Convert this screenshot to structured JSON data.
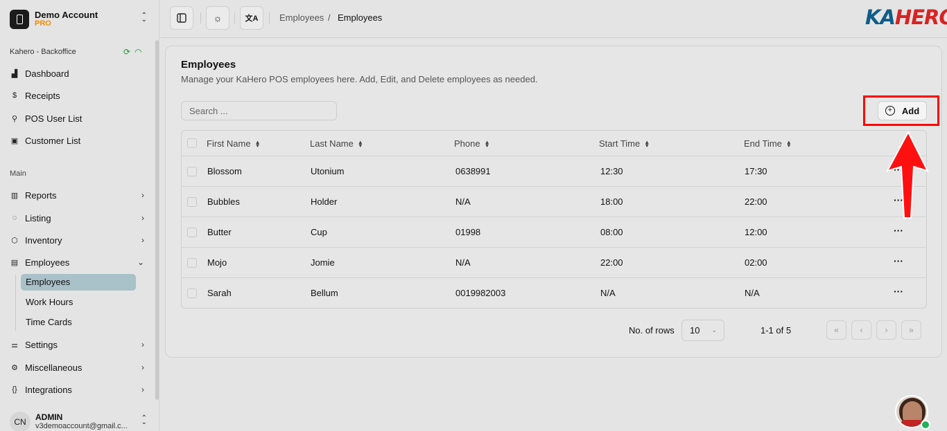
{
  "account": {
    "name": "Demo Account",
    "plan": "PRO"
  },
  "org": "Kahero - Backoffice",
  "nav_top": [
    {
      "label": "Dashboard",
      "icon": "chart-icon"
    },
    {
      "label": "Receipts",
      "icon": "receipt-icon"
    },
    {
      "label": "POS User List",
      "icon": "user-icon"
    },
    {
      "label": "Customer List",
      "icon": "contact-icon"
    }
  ],
  "section_label": "Main",
  "nav_main": [
    {
      "label": "Reports",
      "icon": "report-icon"
    },
    {
      "label": "Listing",
      "icon": "apple-icon"
    },
    {
      "label": "Inventory",
      "icon": "box-icon"
    },
    {
      "label": "Employees",
      "icon": "id-card-icon"
    }
  ],
  "employees_sub": [
    "Employees",
    "Work Hours",
    "Time Cards"
  ],
  "nav_bottom": [
    {
      "label": "Settings",
      "icon": "sliders-icon"
    },
    {
      "label": "Miscellaneous",
      "icon": "gear-icon"
    },
    {
      "label": "Integrations",
      "icon": "braces-icon"
    }
  ],
  "user": {
    "initials": "CN",
    "name": "ADMIN",
    "email": "v3demoaccount@gmail.c..."
  },
  "breadcrumb": {
    "parent": "Employees",
    "separator": "/",
    "current": "Employees"
  },
  "brand": {
    "ka": "KA",
    "hero": "HERO",
    "color_ka": "#0f5d8a",
    "color_hero": "#d82323"
  },
  "page": {
    "title": "Employees",
    "subtitle": "Manage your KaHero POS employees here. Add, Edit, and Delete employees as needed.",
    "search_placeholder": "Search ...",
    "add_label": "Add"
  },
  "table": {
    "columns": [
      "First Name",
      "Last Name",
      "Phone",
      "Start Time",
      "End Time"
    ],
    "rows": [
      [
        "Blossom",
        "Utonium",
        "0638991",
        "12:30",
        "17:30"
      ],
      [
        "Bubbles",
        "Holder",
        "N/A",
        "18:00",
        "22:00"
      ],
      [
        "Butter",
        "Cup",
        "01998",
        "08:00",
        "12:00"
      ],
      [
        "Mojo",
        "Jomie",
        "N/A",
        "22:00",
        "02:00"
      ],
      [
        "Sarah",
        "Bellum",
        "0019982003",
        "N/A",
        "N/A"
      ]
    ],
    "row_action": "···"
  },
  "pagination": {
    "rows_label": "No. of rows",
    "rows_value": "10",
    "range": "1-1 of 5"
  },
  "highlight_color": "#ff0000"
}
